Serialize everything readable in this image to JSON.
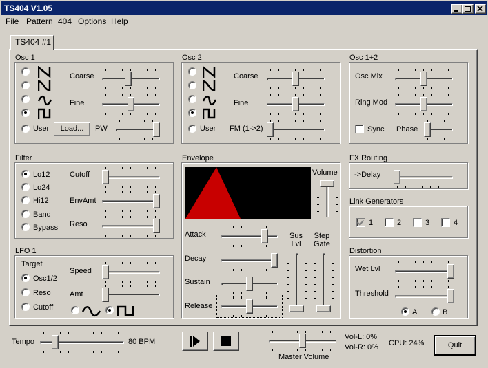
{
  "window": {
    "title": "TS404 V1.05"
  },
  "menu": [
    "File",
    "Pattern",
    "404",
    "Options",
    "Help"
  ],
  "tab": {
    "label": "TS404 #1"
  },
  "osc1": {
    "title": "Osc 1",
    "user": "User",
    "load": "Load...",
    "coarse": "Coarse",
    "fine": "Fine",
    "pw": "PW",
    "waveform": "square",
    "coarse_value": 0.45,
    "fine_value": 0.5,
    "pw_value": 1.0
  },
  "osc2": {
    "title": "Osc 2",
    "user": "User",
    "coarse": "Coarse",
    "fine": "Fine",
    "fm": "FM (1->2)",
    "waveform": "square",
    "coarse_value": 0.5,
    "fine_value": 0.5,
    "fm_value": 0.0
  },
  "osc12": {
    "title": "Osc 1+2",
    "mix": "Osc Mix",
    "ring": "Ring Mod",
    "sync": "Sync",
    "phase": "Phase",
    "mix_value": 0.5,
    "ring_value": 0.5,
    "phase_value": 0.0,
    "sync_checked": false
  },
  "filter": {
    "title": "Filter",
    "types": [
      "Lo12",
      "Lo24",
      "Hi12",
      "Band",
      "Bypass"
    ],
    "selected": "Lo12",
    "cutoff": "Cutoff",
    "envamt": "EnvAmt",
    "reso": "Reso",
    "cutoff_value": 0.0,
    "envamt_value": 1.0,
    "reso_value": 1.0
  },
  "envelope": {
    "title": "Envelope",
    "volume": "Volume",
    "attack": "Attack",
    "decay": "Decay",
    "sustain": "Sustain",
    "release": "Release",
    "sus_lvl": "Sus\nLvl",
    "step_gate": "Step\nGate",
    "volume_value": 1.0,
    "attack_value": 0.8,
    "decay_value": 1.0,
    "sustain_value": 0.5,
    "release_value": 0.5,
    "sus_lvl_value": 0.0,
    "step_gate_value": 0.0,
    "shape_color": "#c80000"
  },
  "lfo": {
    "title": "LFO 1",
    "target": "Target",
    "targets": [
      "Osc1/2",
      "Reso",
      "Cutoff"
    ],
    "selected": "Osc1/2",
    "speed": "Speed",
    "amt": "Amt",
    "waveform": "square",
    "speed_value": 0.0,
    "amt_value": 0.0
  },
  "fx": {
    "title": "FX Routing",
    "delay": "->Delay",
    "delay_value": 0.0
  },
  "link": {
    "title": "Link Generators",
    "items": [
      "1",
      "2",
      "3",
      "4"
    ],
    "checked": [
      "1"
    ]
  },
  "distortion": {
    "title": "Distortion",
    "wet": "Wet Lvl",
    "threshold": "Threshold",
    "a": "A",
    "b": "B",
    "mode": "A",
    "wet_value": 1.0,
    "threshold_value": 1.0
  },
  "bottom": {
    "tempo": "Tempo",
    "bpm": "80 BPM",
    "tempo_value": 0.15,
    "master": "Master Volume",
    "master_value": 0.5,
    "voll": "Vol-L: 0%",
    "volr": "Vol-R: 0%",
    "cpu": "CPU: 24%",
    "quit": "Quit"
  }
}
